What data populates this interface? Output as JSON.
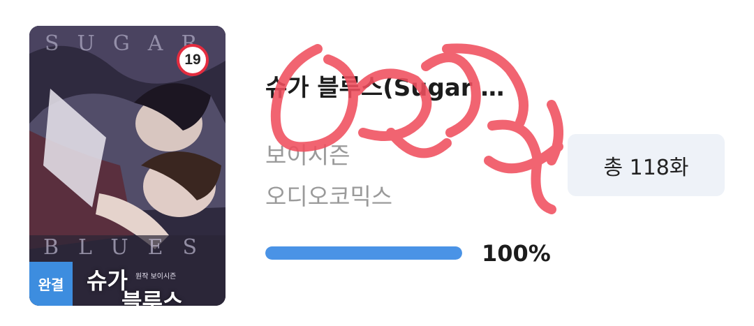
{
  "cover": {
    "title_en_top": "SUGAR",
    "title_en_bottom": "BLUES",
    "title_kr_line1": "슈가",
    "title_kr_line2": "블루스",
    "author_small": "원작 보이시즌",
    "age_rating": "19",
    "status_badge": "완결"
  },
  "item": {
    "title": "슈가 블루스(Sugar …",
    "author": "보이시즌",
    "publisher": "오디오코믹스",
    "episode_count": "총 118화",
    "progress_label": "100%",
    "progress_value": 1.0
  },
  "colors": {
    "progress": "#4a93e6",
    "complete_badge": "#3d8ddf",
    "age_badge_ring": "#e32c3f",
    "scribble": "#f04f5e"
  }
}
